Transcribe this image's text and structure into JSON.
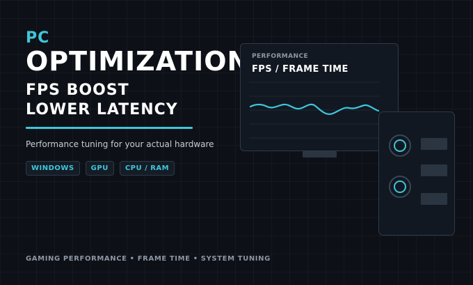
{
  "hero": {
    "eyebrow": "PC",
    "title": "OPTIMIZATION",
    "line1": "FPS BOOST",
    "line2": "LOWER LATENCY",
    "description": "Performance tuning for your actual hardware"
  },
  "tags": [
    "WINDOWS",
    "GPU",
    "CPU / RAM"
  ],
  "monitor": {
    "label": "PERFORMANCE",
    "title": "FPS / FRAME TIME"
  },
  "footer": "GAMING PERFORMANCE • FRAME TIME • SYSTEM TUNING",
  "colors": {
    "background": "#0d1117",
    "accent": "#3ec6db",
    "panel": "#111821",
    "border": "#2f3b48",
    "muted_text": "#8d96a3"
  }
}
